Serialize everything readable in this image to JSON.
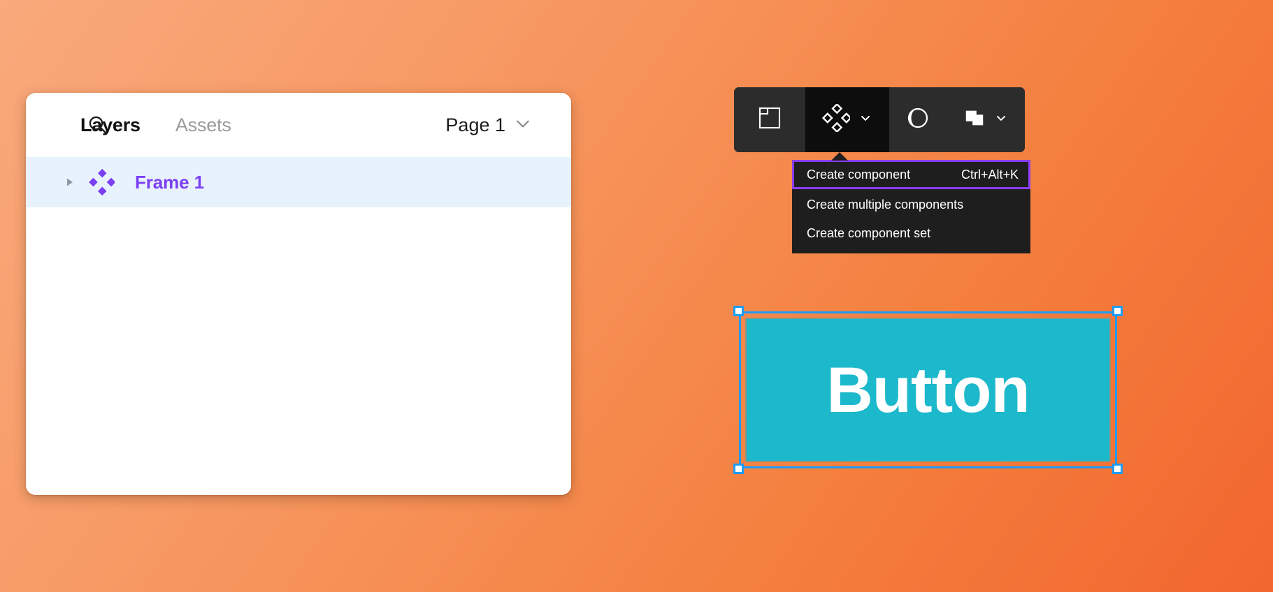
{
  "canvas": {
    "background_from": "#F9A97C",
    "background_to": "#F2662F"
  },
  "layers_panel": {
    "search_icon": "search-icon",
    "tabs": [
      {
        "label": "Layers",
        "active": true
      },
      {
        "label": "Assets",
        "active": false
      }
    ],
    "page_selector": {
      "label": "Page 1",
      "chevron": "chevron-down-icon"
    },
    "rows": [
      {
        "name": "Frame 1",
        "icon": "component-icon",
        "icon_color": "#7B3FF2",
        "text_color": "#7B3FF2",
        "selected": true,
        "expanded": false,
        "disclosure": "triangle-right-icon"
      }
    ]
  },
  "toolbar": {
    "background": "#2C2C2C",
    "active_background": "#0D0D0D",
    "buttons": [
      {
        "icon": "frame-icon",
        "label": "Frame",
        "has_chevron": false,
        "active": false
      },
      {
        "icon": "component-icon",
        "label": "Create component",
        "has_chevron": true,
        "active": true
      },
      {
        "icon": "mask-icon",
        "label": "Use as mask",
        "has_chevron": false,
        "active": false
      },
      {
        "icon": "boolean-union-icon",
        "label": "Boolean groups",
        "has_chevron": true,
        "active": false
      }
    ]
  },
  "dropdown": {
    "background": "#1E1E1E",
    "highlight_color": "#8B3DFF",
    "items": [
      {
        "label": "Create component",
        "shortcut": "Ctrl+Alt+K",
        "highlighted": true
      },
      {
        "label": "Create multiple components",
        "shortcut": "",
        "highlighted": false
      },
      {
        "label": "Create component set",
        "shortcut": "",
        "highlighted": false
      }
    ]
  },
  "canvas_object": {
    "label": "Button",
    "fill": "#1CB8CC",
    "text_color": "#FFFFFF",
    "selected": true,
    "selection_color": "#1E9CF5"
  }
}
